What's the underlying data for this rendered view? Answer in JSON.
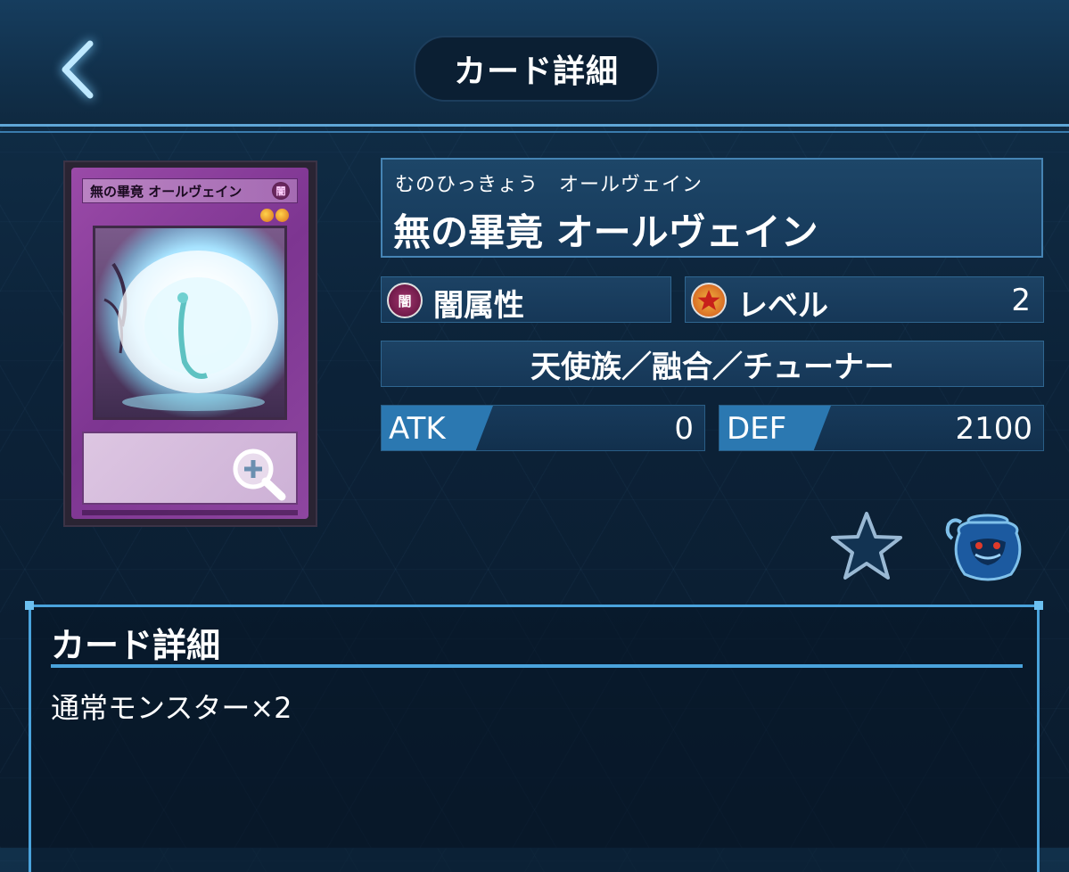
{
  "header": {
    "title": "カード詳細"
  },
  "card": {
    "name_reading": "むのひっきょう　オールヴェイン",
    "name": "無の畢竟 オールヴェイン",
    "image_name": "無の畢竟 オールヴェイン",
    "image_attr_glyph": "闇",
    "attribute": {
      "glyph": "闇",
      "label": "闇属性"
    },
    "level": {
      "label": "レベル",
      "value": "2"
    },
    "type_line": "天使族／融合／チューナー",
    "atk": {
      "label": "ATK",
      "value": "0"
    },
    "def": {
      "label": "DEF",
      "value": "2100"
    }
  },
  "detail": {
    "heading": "カード詳細",
    "text": "通常モンスター×2"
  },
  "colors": {
    "accent": "#4aa3dc",
    "attribute_dark": "#8b1f5c",
    "level_orange": "#e6862a",
    "background": "#0c2238"
  },
  "icons": {
    "back": "chevron-left-icon",
    "zoom": "zoom-in-icon",
    "favorite": "star-icon",
    "pot": "pot-of-greed-icon"
  }
}
